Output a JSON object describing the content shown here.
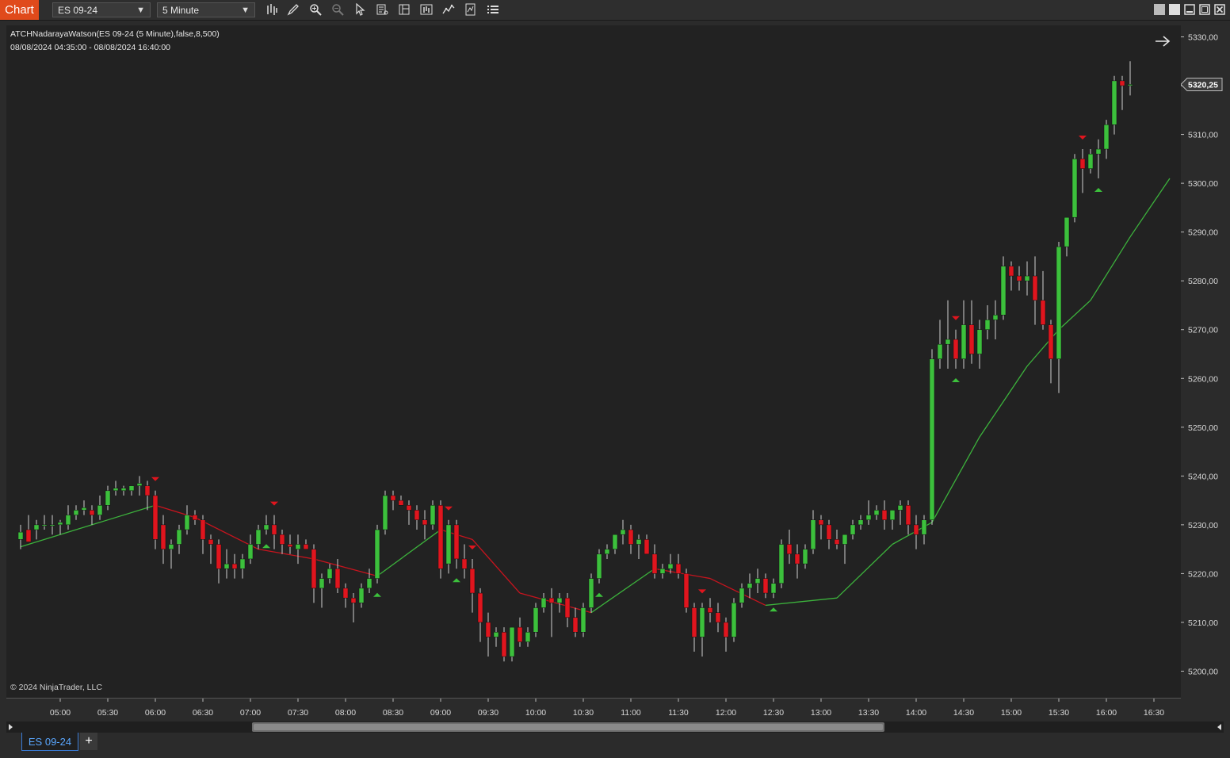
{
  "toolbar": {
    "chart_label": "Chart",
    "instrument": "ES 09-24",
    "interval": "5 Minute",
    "icons": [
      "bars-type-icon",
      "draw-pencil-icon",
      "zoom-in-icon",
      "zoom-out-icon",
      "pointer-icon",
      "data-box-icon",
      "chart-style-icon",
      "chart-trader-icon",
      "indicators-icon",
      "templates-icon",
      "properties-icon"
    ],
    "window_icons": [
      "restore-icon",
      "tile-icon",
      "maximize-icon",
      "close-icon"
    ]
  },
  "chart": {
    "indicator_label": "ATCHNadarayaWatson(ES 09-24 (5 Minute),false,8,500)",
    "range_label": "08/08/2024 04:35:00 - 08/08/2024 16:40:00",
    "copyright": "© 2024 NinjaTrader, LLC",
    "last_price_label": "5320,25",
    "colors": {
      "up": "#3cc03c",
      "down": "#e0151e",
      "wick": "#d0d0d0",
      "nw_up": "#3cb23c",
      "nw_down": "#c8141e",
      "background": "#222222"
    }
  },
  "tabs": [
    {
      "label": "ES 09-24",
      "active": true
    }
  ],
  "add_tab_label": "+",
  "chart_data": {
    "type": "candlestick",
    "ylim": [
      5195,
      5333
    ],
    "yticks": [
      "5330,00",
      "5320,00",
      "5310,00",
      "5300,00",
      "5290,00",
      "5280,00",
      "5270,00",
      "5260,00",
      "5250,00",
      "5240,00",
      "5230,00",
      "5220,00",
      "5210,00",
      "5200,00"
    ],
    "ytick_values": [
      5330,
      5320,
      5310,
      5300,
      5290,
      5280,
      5270,
      5260,
      5250,
      5240,
      5230,
      5220,
      5210,
      5200
    ],
    "xticks": [
      "05:00",
      "05:30",
      "06:00",
      "06:30",
      "07:00",
      "07:30",
      "08:00",
      "08:30",
      "09:00",
      "09:30",
      "10:00",
      "10:30",
      "11:00",
      "11:30",
      "12:00",
      "12:30",
      "13:00",
      "13:30",
      "14:00",
      "14:30",
      "15:00",
      "15:30",
      "16:00",
      "16:30"
    ],
    "bar_interval_minutes": 5,
    "time_range": [
      "04:35",
      "16:40"
    ],
    "ohlc": [
      [
        5227,
        5230,
        5225,
        5228.5
      ],
      [
        5229,
        5232,
        5227,
        5226.5
      ],
      [
        5229,
        5231,
        5227,
        5230
      ],
      [
        5230,
        5232,
        5229,
        5230
      ],
      [
        5230,
        5232,
        5228,
        5230
      ],
      [
        5230,
        5231,
        5228,
        5230.5
      ],
      [
        5230,
        5234,
        5229,
        5232
      ],
      [
        5232,
        5234,
        5231,
        5233
      ],
      [
        5233,
        5235,
        5232,
        5233.5
      ],
      [
        5233,
        5234,
        5230,
        5232
      ],
      [
        5232,
        5236,
        5231,
        5234
      ],
      [
        5234,
        5238,
        5233,
        5237
      ],
      [
        5237,
        5239,
        5236,
        5237.5
      ],
      [
        5237,
        5238,
        5236,
        5237.5
      ],
      [
        5237,
        5238,
        5236,
        5238
      ],
      [
        5238,
        5240,
        5236,
        5238.5
      ],
      [
        5238,
        5239,
        5233,
        5236
      ],
      [
        5236,
        5237,
        5225,
        5227
      ],
      [
        5230,
        5232,
        5222,
        5225
      ],
      [
        5225,
        5227,
        5221,
        5226
      ],
      [
        5226,
        5230,
        5224,
        5229
      ],
      [
        5229,
        5234,
        5228,
        5232
      ],
      [
        5232,
        5233,
        5230,
        5231
      ],
      [
        5231,
        5232,
        5224,
        5227
      ],
      [
        5227,
        5228,
        5222,
        5226
      ],
      [
        5226,
        5227,
        5218,
        5221
      ],
      [
        5221,
        5225,
        5219,
        5222
      ],
      [
        5222,
        5224,
        5219,
        5221
      ],
      [
        5221,
        5224,
        5219,
        5223
      ],
      [
        5223,
        5228,
        5222,
        5226
      ],
      [
        5226,
        5230,
        5225,
        5229
      ],
      [
        5229,
        5232,
        5228,
        5230
      ],
      [
        5230,
        5232,
        5225,
        5228
      ],
      [
        5228,
        5229,
        5224,
        5226
      ],
      [
        5226,
        5228,
        5224,
        5225.5
      ],
      [
        5225,
        5228,
        5222,
        5226
      ],
      [
        5226,
        5227,
        5225,
        5225
      ],
      [
        5225,
        5226,
        5214,
        5217
      ],
      [
        5217,
        5220,
        5213,
        5219
      ],
      [
        5219,
        5222,
        5218,
        5221
      ],
      [
        5221,
        5223,
        5216,
        5217
      ],
      [
        5217,
        5218,
        5213,
        5215
      ],
      [
        5215,
        5216,
        5210,
        5214
      ],
      [
        5214,
        5218,
        5213,
        5217
      ],
      [
        5217,
        5221,
        5216,
        5219
      ],
      [
        5219,
        5230,
        5218,
        5229
      ],
      [
        5229,
        5237,
        5228,
        5236
      ],
      [
        5236,
        5237,
        5233,
        5235
      ],
      [
        5235,
        5236,
        5234,
        5234
      ],
      [
        5234,
        5235,
        5230,
        5233
      ],
      [
        5233,
        5234,
        5229,
        5231
      ],
      [
        5231,
        5233,
        5227,
        5230
      ],
      [
        5230,
        5235,
        5229,
        5234
      ],
      [
        5234,
        5235,
        5219,
        5221
      ],
      [
        5222,
        5231,
        5220,
        5230
      ],
      [
        5230,
        5231,
        5221,
        5223
      ],
      [
        5223,
        5226,
        5219,
        5221
      ],
      [
        5221,
        5223,
        5212,
        5216
      ],
      [
        5216,
        5217,
        5206,
        5210
      ],
      [
        5210,
        5212,
        5203,
        5207
      ],
      [
        5207,
        5209,
        5205,
        5208
      ],
      [
        5208,
        5209,
        5202,
        5203
      ],
      [
        5203,
        5209,
        5202,
        5209
      ],
      [
        5209,
        5211,
        5205,
        5206
      ],
      [
        5206,
        5209,
        5205,
        5208
      ],
      [
        5208,
        5214,
        5207,
        5213
      ],
      [
        5213,
        5216,
        5212,
        5215
      ],
      [
        5215,
        5217,
        5207,
        5214
      ],
      [
        5214,
        5216,
        5212,
        5215
      ],
      [
        5215,
        5216,
        5209,
        5211
      ],
      [
        5211,
        5213,
        5207,
        5208
      ],
      [
        5208,
        5214,
        5207,
        5213
      ],
      [
        5213,
        5220,
        5212,
        5219
      ],
      [
        5219,
        5225,
        5218,
        5224
      ],
      [
        5224,
        5226,
        5223,
        5225
      ],
      [
        5225,
        5228,
        5224,
        5228
      ],
      [
        5228,
        5231,
        5226,
        5229
      ],
      [
        5229,
        5230,
        5224,
        5226
      ],
      [
        5226,
        5228,
        5223,
        5227
      ],
      [
        5227,
        5228,
        5224,
        5224
      ],
      [
        5224,
        5226,
        5219,
        5220
      ],
      [
        5220,
        5222,
        5219,
        5221
      ],
      [
        5221,
        5224,
        5220,
        5222
      ],
      [
        5222,
        5224,
        5219,
        5220
      ],
      [
        5220,
        5221,
        5212,
        5213
      ],
      [
        5213,
        5214,
        5204,
        5207
      ],
      [
        5207,
        5214,
        5203,
        5213
      ],
      [
        5213,
        5215,
        5210,
        5212
      ],
      [
        5212,
        5214,
        5208,
        5210
      ],
      [
        5210,
        5211,
        5204,
        5207
      ],
      [
        5207,
        5215,
        5206,
        5214
      ],
      [
        5214,
        5218,
        5213,
        5217
      ],
      [
        5217,
        5220,
        5215,
        5218
      ],
      [
        5218,
        5221,
        5216,
        5219
      ],
      [
        5219,
        5220,
        5215,
        5216
      ],
      [
        5216,
        5219,
        5215,
        5218
      ],
      [
        5218,
        5227,
        5217,
        5226
      ],
      [
        5226,
        5229,
        5222,
        5224
      ],
      [
        5224,
        5226,
        5219,
        5222
      ],
      [
        5222,
        5226,
        5221,
        5225
      ],
      [
        5225,
        5233,
        5224,
        5231
      ],
      [
        5231,
        5232,
        5227,
        5230
      ],
      [
        5230,
        5231,
        5225,
        5227
      ],
      [
        5227,
        5229,
        5225,
        5226
      ],
      [
        5226,
        5228,
        5222,
        5228
      ],
      [
        5228,
        5231,
        5227,
        5230
      ],
      [
        5230,
        5232,
        5229,
        5231
      ],
      [
        5231,
        5235,
        5230,
        5232
      ],
      [
        5232,
        5234,
        5231,
        5233
      ],
      [
        5233,
        5235,
        5229,
        5231
      ],
      [
        5231,
        5233,
        5229,
        5233
      ],
      [
        5233,
        5235,
        5230,
        5234
      ],
      [
        5234,
        5235,
        5228,
        5230
      ],
      [
        5230,
        5232,
        5225,
        5228
      ],
      [
        5228,
        5232,
        5226,
        5231
      ],
      [
        5231,
        5266,
        5230,
        5264
      ],
      [
        5264,
        5272,
        5262,
        5267
      ],
      [
        5267,
        5276,
        5262,
        5268
      ],
      [
        5268,
        5270,
        5262,
        5264
      ],
      [
        5264,
        5276,
        5262,
        5271
      ],
      [
        5271,
        5276,
        5263,
        5265
      ],
      [
        5265,
        5272,
        5262,
        5270
      ],
      [
        5270,
        5275,
        5268,
        5272
      ],
      [
        5272,
        5276,
        5268,
        5273
      ],
      [
        5273,
        5285,
        5272,
        5283
      ],
      [
        5283,
        5284,
        5278,
        5281
      ],
      [
        5281,
        5283,
        5278,
        5280
      ],
      [
        5280,
        5284,
        5277,
        5281
      ],
      [
        5281,
        5285,
        5271,
        5276
      ],
      [
        5276,
        5282,
        5270,
        5271
      ],
      [
        5271,
        5272,
        5259,
        5264
      ],
      [
        5264,
        5288,
        5257,
        5287
      ],
      [
        5287,
        5293,
        5285,
        5293
      ],
      [
        5293,
        5306,
        5292,
        5305
      ],
      [
        5305,
        5307,
        5298,
        5303
      ],
      [
        5303,
        5307,
        5302,
        5306
      ],
      [
        5306,
        5309,
        5301,
        5307
      ],
      [
        5307,
        5313,
        5305,
        5312
      ],
      [
        5312,
        5322,
        5310,
        5321
      ],
      [
        5321,
        5322,
        5315,
        5320
      ],
      [
        5320,
        5325,
        5318,
        5320.25
      ]
    ],
    "nw_line": [
      [
        0,
        5225.5
      ],
      [
        10,
        5230.5
      ],
      [
        17,
        5234
      ],
      [
        22,
        5231.5
      ],
      [
        30,
        5225
      ],
      [
        37,
        5223
      ],
      [
        45,
        5219.5
      ],
      [
        53,
        5229
      ],
      [
        57,
        5227
      ],
      [
        63,
        5216
      ],
      [
        72,
        5212
      ],
      [
        80,
        5221
      ],
      [
        87,
        5219
      ],
      [
        94,
        5213.5
      ],
      [
        103,
        5215
      ],
      [
        110,
        5226
      ],
      [
        115,
        5230.5
      ],
      [
        121,
        5248
      ],
      [
        127,
        5262.5
      ],
      [
        131,
        5270
      ],
      [
        135,
        5276
      ],
      [
        140,
        5289
      ],
      [
        145,
        5301
      ]
    ],
    "signals_buy": [
      31,
      45,
      55,
      73,
      95,
      118,
      136
    ],
    "signals_sell": [
      17,
      32,
      54,
      57,
      86,
      118,
      134
    ]
  }
}
